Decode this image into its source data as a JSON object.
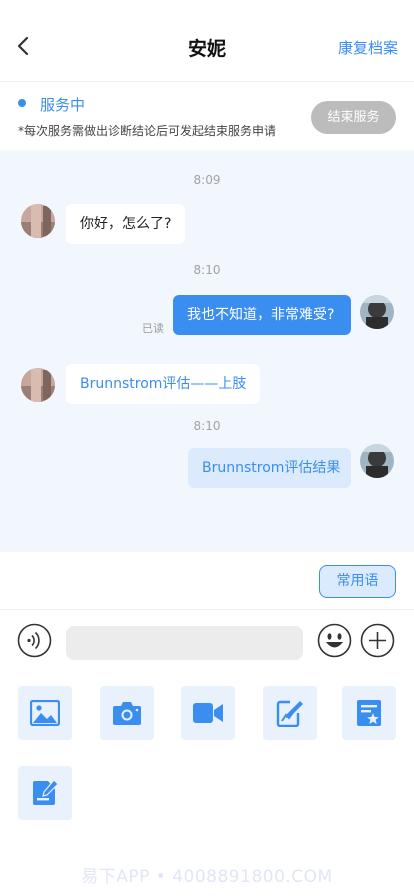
{
  "header": {
    "title": "安妮",
    "archive_label": "康复档案"
  },
  "status": {
    "label": "服务中",
    "note": "*每次服务需做出诊断结论后可发起结束服务申请",
    "end_button_label": "结束服务"
  },
  "messages": [
    {
      "time": "8:09"
    },
    {
      "text": "你好，怎么了?"
    },
    {
      "time": "8:10"
    },
    {
      "text": "我也不知道，非常难受?",
      "read_label": "已读"
    },
    {
      "text": "Brunnstrom评估——上肢"
    },
    {
      "time": "8:10"
    },
    {
      "text": "Brunnstrom评估结果"
    }
  ],
  "phrases_button_label": "常用语",
  "input": {
    "value": "",
    "placeholder": ""
  },
  "toolbar_icons": [
    "image-icon",
    "camera-icon",
    "video-icon",
    "edit-form-icon",
    "favorite-form-icon",
    "note-icon"
  ],
  "watermark": "易下APP • 4008891800.COM",
  "colors": {
    "accent": "#3a8ef0",
    "chat_background": "#f2f7fe",
    "outgoing_light": "#dbeafd",
    "end_button": "#bcbcbc"
  }
}
